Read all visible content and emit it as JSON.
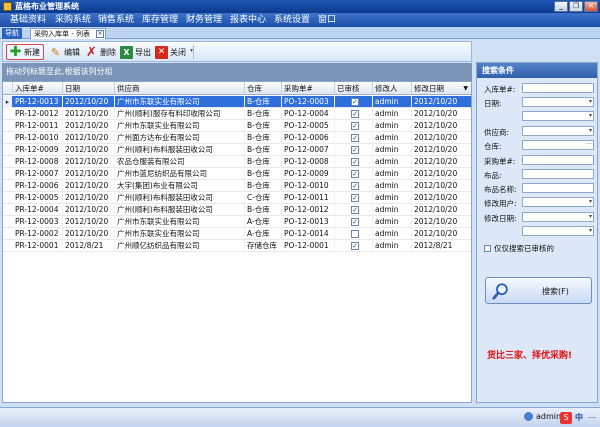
{
  "window": {
    "title": "蓝格布业管理系统",
    "min_label": "_",
    "restore_label": "❐",
    "close_label": "✕"
  },
  "menu": [
    "基础资料",
    "采购系统",
    "销售系统",
    "库存管理",
    "财务管理",
    "报表中心",
    "系统设置",
    "窗口"
  ],
  "tabs": {
    "nav_label": "导航",
    "doc_label": "采购入库单 - 列表",
    "close_label": "×"
  },
  "toolbar": {
    "new_label": "新建",
    "edit_label": "编辑",
    "delete_label": "删除",
    "export_label": "导出",
    "close_label": "关闭"
  },
  "group_hint": "拖动列标题至此,根据该列分组",
  "grid": {
    "columns": [
      "入库单#",
      "日期",
      "供应商",
      "仓库",
      "采购单#",
      "已审核",
      "修改人",
      "修改日期"
    ],
    "rows": [
      {
        "no": "PR-12-0013",
        "date": "2012/10/20",
        "supplier": "广州市东联实业有限公司",
        "warehouse": "B-仓库",
        "po": "PO-12-0003",
        "audited": true,
        "modifier": "admin",
        "mod_date": "2012/10/20"
      },
      {
        "no": "PR-12-0012",
        "date": "2012/10/20",
        "supplier": "广州(顺利)服存有料印收限公司",
        "warehouse": "B-仓库",
        "po": "PO-12-0004",
        "audited": true,
        "modifier": "admin",
        "mod_date": "2012/10/20"
      },
      {
        "no": "PR-12-0011",
        "date": "2012/10/20",
        "supplier": "广州市东联实业有限公司",
        "warehouse": "B-仓库",
        "po": "PO-12-0005",
        "audited": true,
        "modifier": "admin",
        "mod_date": "2012/10/20"
      },
      {
        "no": "PR-12-0010",
        "date": "2012/10/20",
        "supplier": "广州面方达布业有限公司",
        "warehouse": "B-仓库",
        "po": "PO-12-0006",
        "audited": true,
        "modifier": "admin",
        "mod_date": "2012/10/20"
      },
      {
        "no": "PR-12-0009",
        "date": "2012/10/20",
        "supplier": "广州(顺利)布料服装田收公司",
        "warehouse": "B-仓库",
        "po": "PO-12-0007",
        "audited": true,
        "modifier": "admin",
        "mod_date": "2012/10/20"
      },
      {
        "no": "PR-12-0008",
        "date": "2012/10/20",
        "supplier": "农品仓服装有限公司",
        "warehouse": "B-仓库",
        "po": "PO-12-0008",
        "audited": true,
        "modifier": "admin",
        "mod_date": "2012/10/20"
      },
      {
        "no": "PR-12-0007",
        "date": "2012/10/20",
        "supplier": "广州市蓝尼纺织品有限公司",
        "warehouse": "B-仓库",
        "po": "PO-12-0009",
        "audited": true,
        "modifier": "admin",
        "mod_date": "2012/10/20"
      },
      {
        "no": "PR-12-0006",
        "date": "2012/10/20",
        "supplier": "大宇(集团)布业有限公司",
        "warehouse": "B-仓库",
        "po": "PO-12-0010",
        "audited": true,
        "modifier": "admin",
        "mod_date": "2012/10/20"
      },
      {
        "no": "PR-12-0005",
        "date": "2012/10/20",
        "supplier": "广州(顺利)布料服装田收公司",
        "warehouse": "C-仓库",
        "po": "PO-12-0011",
        "audited": true,
        "modifier": "admin",
        "mod_date": "2012/10/20"
      },
      {
        "no": "PR-12-0004",
        "date": "2012/10/20",
        "supplier": "广州(顺利)布料服装田收公司",
        "warehouse": "B-仓库",
        "po": "PO-12-0012",
        "audited": true,
        "modifier": "admin",
        "mod_date": "2012/10/20"
      },
      {
        "no": "PR-12-0003",
        "date": "2012/10/20",
        "supplier": "广州市东联实业有限公司",
        "warehouse": "A-仓库",
        "po": "PO-12-0013",
        "audited": true,
        "modifier": "admin",
        "mod_date": "2012/10/20"
      },
      {
        "no": "PR-12-0002",
        "date": "2012/10/20",
        "supplier": "广州市东联实业有限公司",
        "warehouse": "A-仓库",
        "po": "PO-12-0014",
        "audited": false,
        "modifier": "admin",
        "mod_date": "2012/10/20"
      },
      {
        "no": "PR-12-0001",
        "date": "2012/8/21",
        "supplier": "广州顺亿纺织品有限公司",
        "warehouse": "存储仓库",
        "po": "PO-12-0001",
        "audited": true,
        "modifier": "admin",
        "mod_date": "2012/8/21"
      }
    ]
  },
  "search_panel": {
    "title": "搜索条件",
    "fields": [
      {
        "label": "入库单#:",
        "type": "text"
      },
      {
        "label": "日期:",
        "type": "select"
      },
      {
        "label": "",
        "type": "select"
      },
      {
        "label": "供应商:",
        "type": "select"
      },
      {
        "label": "仓库:",
        "type": "ellipsis"
      },
      {
        "label": "采购单#:",
        "type": "text"
      },
      {
        "label": "布品:",
        "type": "text"
      },
      {
        "label": "布品名称:",
        "type": "text"
      },
      {
        "label": "修改用户:",
        "type": "select"
      },
      {
        "label": "修改日期:",
        "type": "select"
      },
      {
        "label": "",
        "type": "select"
      }
    ],
    "audited_only_label": "仅仅搜索已审核的",
    "search_button_label": "搜索(F)",
    "slogan": "货比三家、择优采购!"
  },
  "status": {
    "user": "admin",
    "ime_label": "中"
  },
  "colors": {
    "selected_row": "#2f6fdc",
    "slogan": "#e01010",
    "titlebar": "#0b3a8f"
  }
}
